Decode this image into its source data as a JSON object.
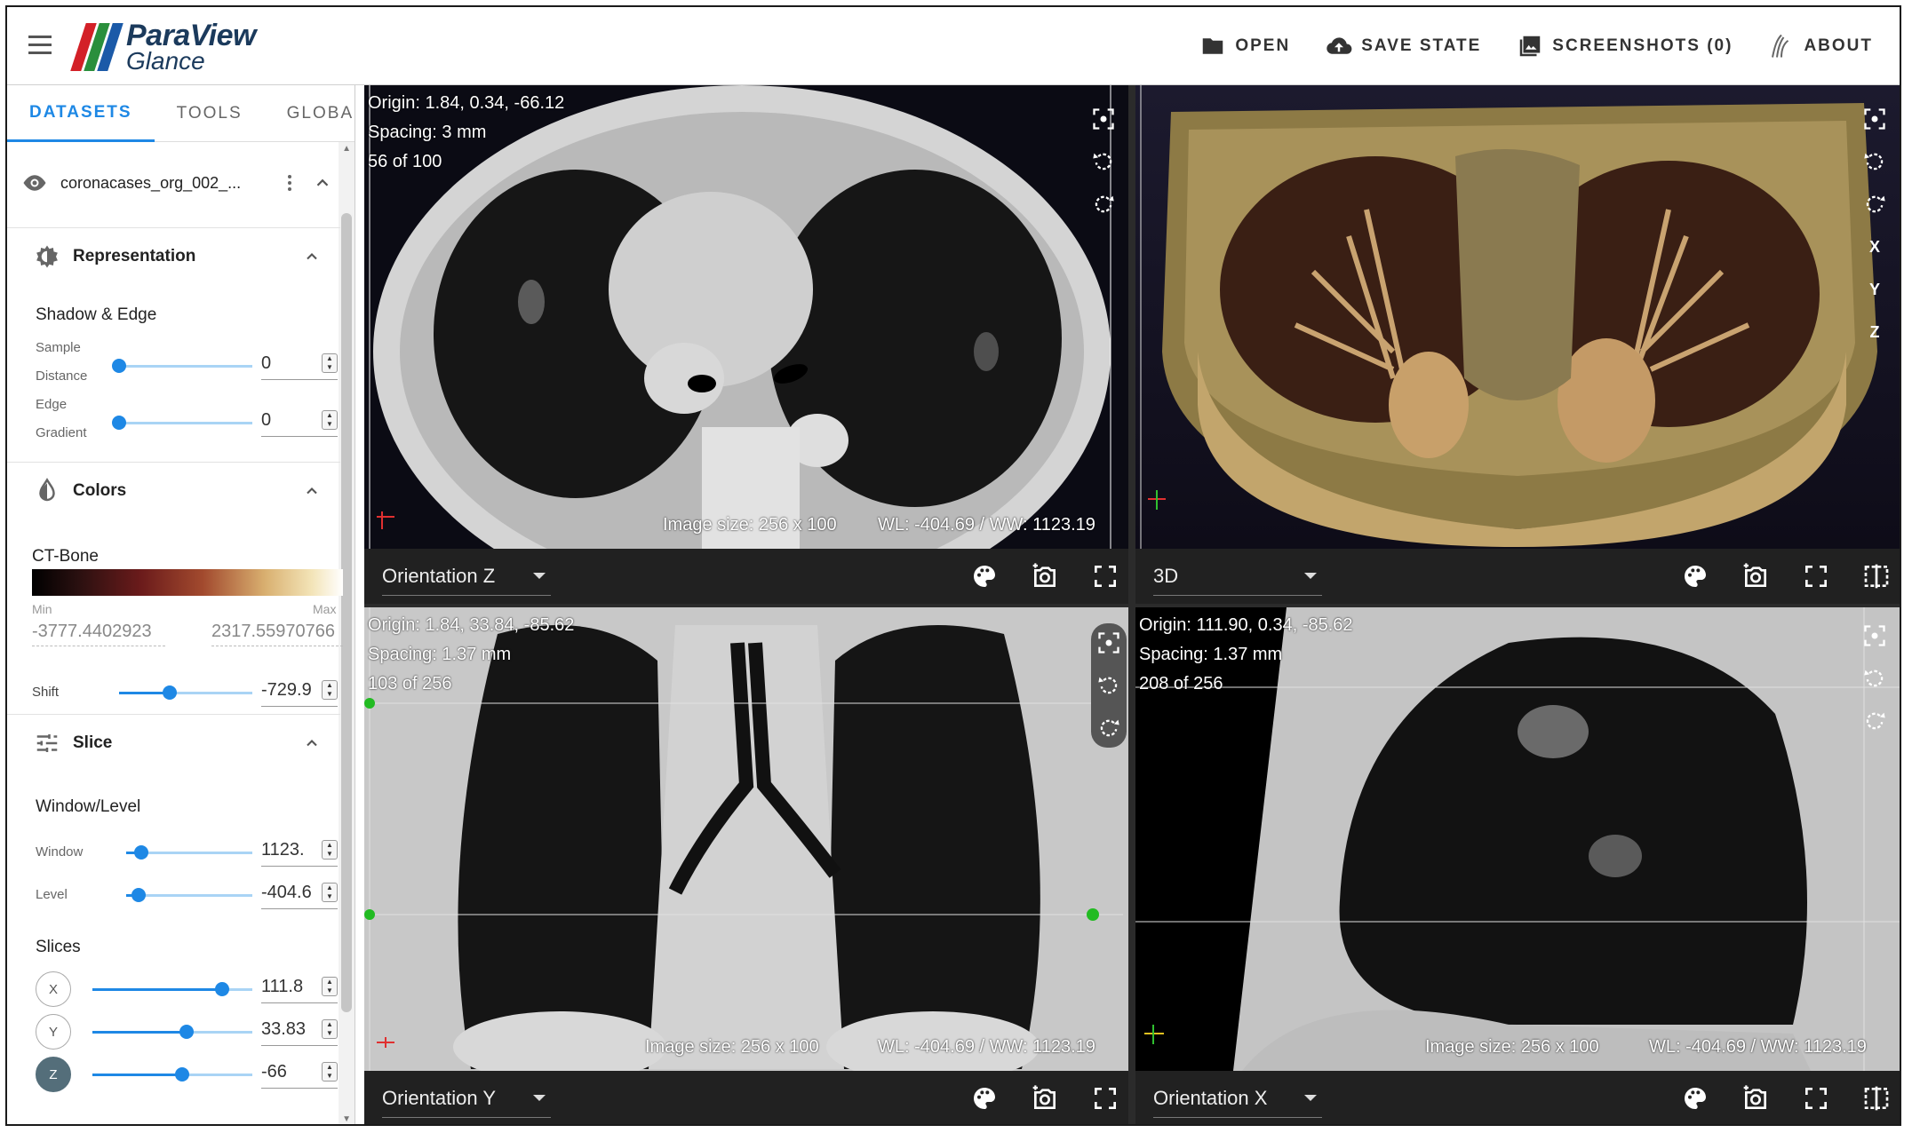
{
  "header": {
    "logo_line1": "ParaView",
    "logo_line2": "Glance",
    "logo_colors": [
      "#d32027",
      "#2a8f3c",
      "#1b5aa8"
    ],
    "open_label": "OPEN",
    "save_label": "SAVE STATE",
    "screenshots_label": "SCREENSHOTS (0)",
    "about_label": "ABOUT"
  },
  "sidebar": {
    "tabs": [
      {
        "label": "DATASETS",
        "active": true
      },
      {
        "label": "TOOLS",
        "active": false
      },
      {
        "label": "GLOBAL",
        "active": false
      }
    ],
    "dataset_name": "coronacases_org_002_...",
    "representation": {
      "title": "Representation",
      "subtitle": "Shadow & Edge",
      "sample_label": "Sample",
      "distance_label": "Distance",
      "sample_value": "0",
      "sample_level": 0,
      "edge_label": "Edge",
      "gradient_label": "Gradient",
      "edge_value": "0",
      "edge_level": 0
    },
    "colors": {
      "title": "Colors",
      "preset": "CT-Bone",
      "min_label": "Min",
      "max_label": "Max",
      "min_value": "-3777.4402923",
      "max_value": "2317.55970766",
      "shift_label": "Shift",
      "shift_value": "-729.9",
      "shift_level": 0.38
    },
    "slice": {
      "title": "Slice",
      "wl_title": "Window/Level",
      "window_label": "Window",
      "window_value": "1123.",
      "window_level": 0.12,
      "level_label": "Level",
      "level_value": "-404.6",
      "level_level": 0.1,
      "slices_title": "Slices",
      "x_label": "X",
      "x_value": "111.8",
      "x_level": 0.81,
      "y_label": "Y",
      "y_value": "33.83",
      "y_level": 0.59,
      "z_label": "Z",
      "z_value": "-66",
      "z_level": 0.56
    }
  },
  "views": {
    "top_left": {
      "origin": "Origin: 1.84, 0.34, -66.12",
      "spacing": "Spacing: 3 mm",
      "slice": "56 of 100",
      "image_size": "Image size: 256 x 100",
      "wl": "WL: -404.69 / WW: 1123.19",
      "orientation": "Orientation Z"
    },
    "top_right": {
      "orientation": "3D",
      "axis_x": "X",
      "axis_y": "Y",
      "axis_z": "Z"
    },
    "bottom_left": {
      "origin": "Origin: 1.84, 33.84, -85.62",
      "spacing": "Spacing: 1.37 mm",
      "slice": "103 of 256",
      "image_size": "Image size: 256 x 100",
      "wl": "WL: -404.69 / WW: 1123.19",
      "orientation": "Orientation Y"
    },
    "bottom_right": {
      "origin": "Origin: 111.90, 0.34, -85.62",
      "spacing": "Spacing: 1.37 mm",
      "slice": "208 of 256",
      "image_size": "Image size: 256 x 100",
      "wl": "WL: -404.69 / WW: 1123.19",
      "orientation": "Orientation X"
    }
  },
  "colors": {
    "accent": "#1e88e5",
    "viewport_bar": "#212121"
  },
  "icons": [
    "menu-icon",
    "folder-icon",
    "cloud-upload-icon",
    "image-icon",
    "about-logo-icon",
    "eye-icon",
    "more-vert-icon",
    "chevron-up-icon",
    "representation-icon",
    "colors-icon",
    "slice-icon",
    "palette-icon",
    "camera-icon",
    "fullscreen-icon",
    "split-icon",
    "reset-camera-icon",
    "rotate-left-icon",
    "rotate-right-icon"
  ]
}
